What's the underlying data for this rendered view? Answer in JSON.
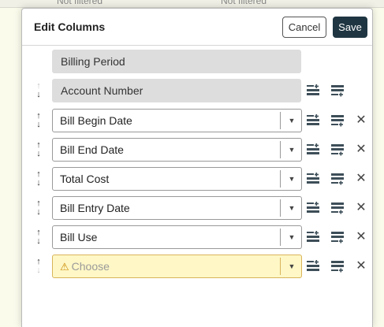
{
  "background": {
    "filter_texts": [
      "Not filtered",
      "Not filtered"
    ]
  },
  "dialog": {
    "title": "Edit Columns",
    "cancel_label": "Cancel",
    "save_label": "Save"
  },
  "fixed_columns": [
    {
      "label": "Billing Period",
      "movable": false
    },
    {
      "label": "Account Number",
      "movable": true
    }
  ],
  "columns": [
    {
      "value": "Bill Begin Date",
      "placeholder": false
    },
    {
      "value": "Bill End Date",
      "placeholder": false
    },
    {
      "value": "Total Cost",
      "placeholder": false
    },
    {
      "value": "Bill Entry Date",
      "placeholder": false
    },
    {
      "value": "Bill Use",
      "placeholder": false
    },
    {
      "value": "Choose",
      "placeholder": true
    }
  ],
  "icons": {
    "move_up": "arrow-up-icon",
    "move_down": "arrow-down-icon",
    "dropdown": "chevron-down-icon",
    "insert_before": "insert-row-before-icon",
    "insert_after": "insert-row-after-icon",
    "remove": "close-icon",
    "warning": "warning-icon"
  },
  "colors": {
    "save_button": "#1f3642",
    "warning_fill": "#fff7c6",
    "warning_border": "#d9b45a",
    "static_fill": "#dddddd"
  }
}
